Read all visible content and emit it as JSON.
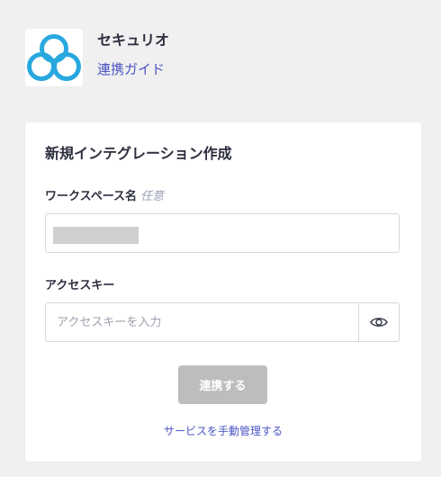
{
  "app": {
    "name": "セキュリオ",
    "guide_link": "連携ガイド",
    "logo_icon": "three-circles-logo",
    "brand_color": "#29a8df"
  },
  "form": {
    "title": "新規インテグレーション作成",
    "workspace": {
      "label": "ワークスペース名",
      "optional_tag": "任意"
    },
    "access_key": {
      "label": "アクセスキー",
      "placeholder": "アクセスキーを入力",
      "toggle_icon": "eye-icon"
    },
    "connect_button": "連携する",
    "manual_link": "サービスを手動管理する"
  },
  "colors": {
    "link": "#4b55c2",
    "button_disabled": "#bdbdbd"
  }
}
